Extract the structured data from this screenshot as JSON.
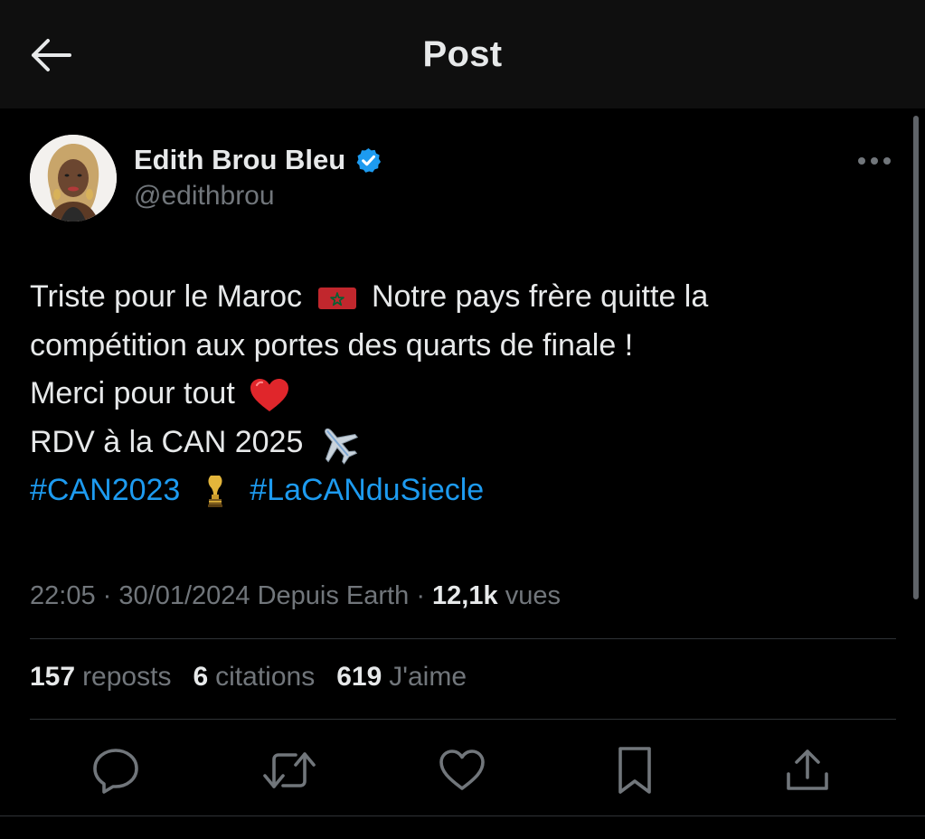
{
  "header": {
    "title": "Post",
    "back_icon": "arrow-left-icon"
  },
  "author": {
    "name": "Edith Brou Bleu",
    "handle": "@edithbrou",
    "verified": true,
    "verified_color": "#1d9bf0"
  },
  "tweet": {
    "line1_a": "Triste pour le Maroc",
    "flag_icon": "morocco-flag-icon",
    "line1_b": "Notre pays frère quitte la",
    "line2": "compétition aux portes des quarts de finale !",
    "line3": "Merci pour tout",
    "heart_emoji": "❤️",
    "line4": "RDV à la CAN 2025",
    "plane_emoji": "✈️",
    "hashtag1": "#CAN2023",
    "trophy_icon": "trophy-icon",
    "hashtag2": "#LaCANduSiecle"
  },
  "meta": {
    "time": "22:05",
    "sep1": "·",
    "date": "30/01/2024",
    "source": "Depuis Earth",
    "sep2": "·",
    "views_count": "12,1k",
    "views_label": "vues"
  },
  "stats": {
    "reposts_count": "157",
    "reposts_label": "reposts",
    "quotes_count": "6",
    "quotes_label": "citations",
    "likes_count": "619",
    "likes_label": "J'aime"
  },
  "actions": [
    "reply-icon",
    "repost-icon",
    "like-icon",
    "bookmark-icon",
    "share-icon"
  ],
  "colors": {
    "background": "#000000",
    "header_bg": "#0f0f0f",
    "text_primary": "#e7e9ea",
    "text_secondary": "#71767b",
    "link": "#1d9bf0",
    "divider": "#2f3336"
  }
}
